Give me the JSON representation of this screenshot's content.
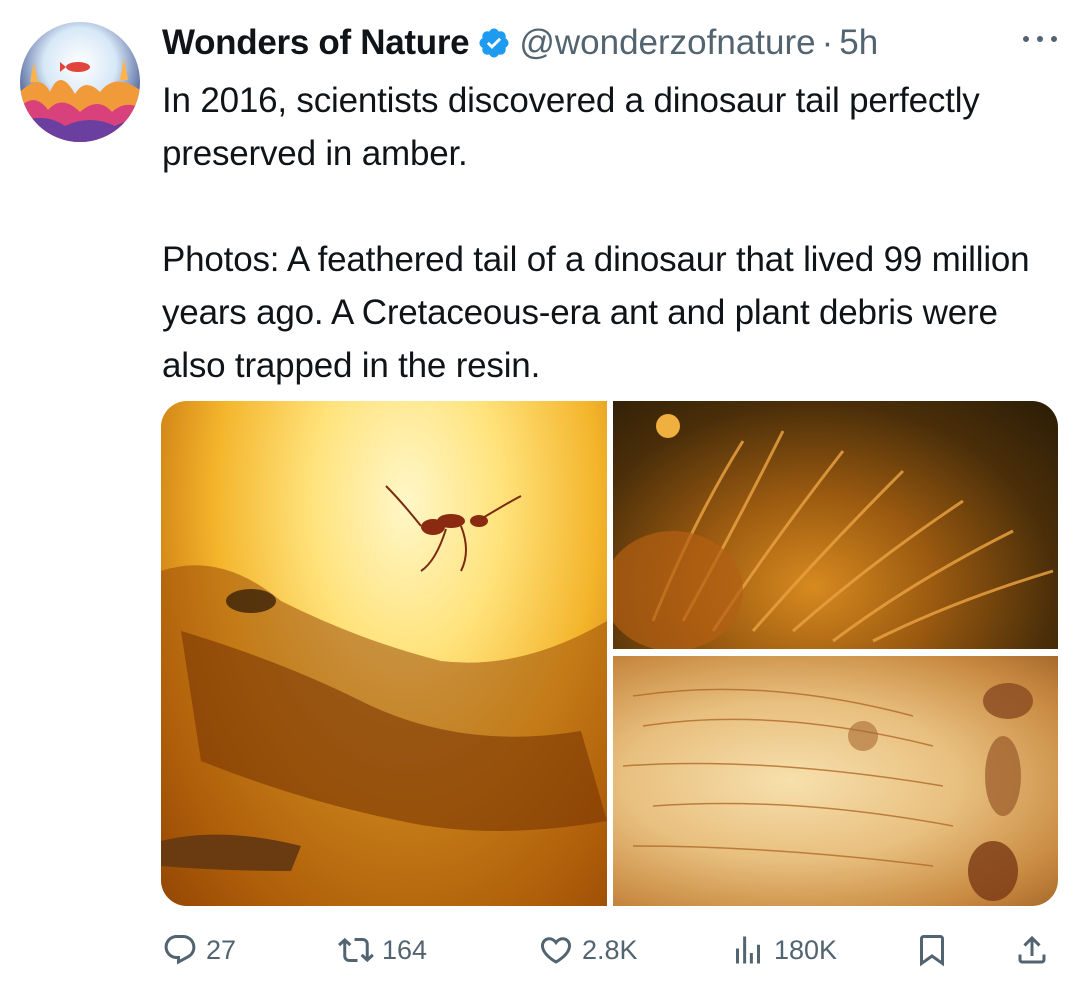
{
  "tweet": {
    "display_name": "Wonders of Nature",
    "handle": "@wonderzofnature",
    "separator": "·",
    "time": "5h",
    "verified": true,
    "paragraph_1": "In 2016, scientists discovered a dinosaur tail perfectly preserved in amber.",
    "paragraph_2": "Photos: A feathered tail of a dinosaur that lived 99 million years ago. A Cretaceous-era ant and plant debris were also trapped in the resin."
  },
  "actions": {
    "replies": "27",
    "reposts": "164",
    "likes": "2.8K",
    "views": "180K"
  },
  "icons": {
    "more": "more-icon",
    "verified": "verified-badge-icon",
    "reply": "reply-icon",
    "repost": "repost-icon",
    "like": "heart-icon",
    "views": "views-icon",
    "bookmark": "bookmark-icon",
    "share": "share-icon"
  },
  "colors": {
    "text": "#0f1419",
    "secondary": "#536471",
    "verified": "#1d9bf0"
  }
}
